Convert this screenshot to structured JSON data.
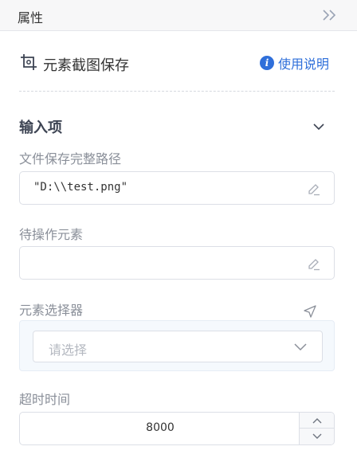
{
  "header": {
    "title": "属性"
  },
  "component": {
    "title": "元素截图保存",
    "help_label": "使用说明"
  },
  "section": {
    "title": "输入项"
  },
  "fields": {
    "file_path": {
      "label": "文件保存完整路径",
      "value": "\"D:\\\\test.png\""
    },
    "target_element": {
      "label": "待操作元素",
      "value": ""
    },
    "element_selector": {
      "label": "元素选择器",
      "placeholder": "请选择"
    },
    "timeout": {
      "label": "超时时间",
      "value": "8000"
    }
  },
  "colors": {
    "accent": "#2f6fda",
    "label": "#8a8f99",
    "border": "#dcdfe6"
  },
  "icons": [
    "double-chevron-right-icon",
    "crop-icon",
    "info-icon",
    "chevron-down-icon",
    "edit-icon",
    "cursor-arrow-icon",
    "chevron-up-icon"
  ]
}
